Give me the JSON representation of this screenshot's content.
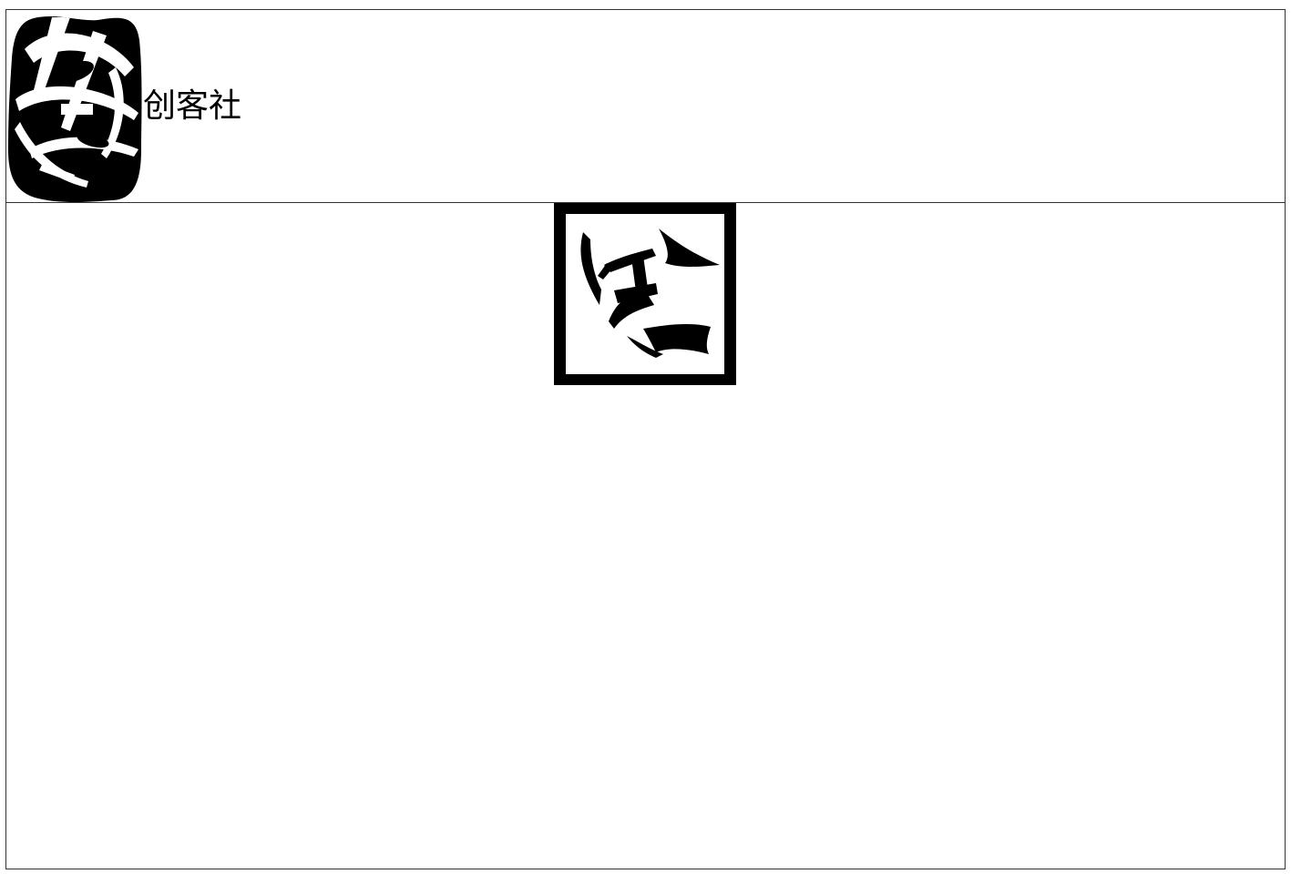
{
  "header": {
    "brand_name": "创客社",
    "logo_icon": "abstract-black-white-logo-icon"
  },
  "main": {
    "emblem_icon": "framed-calligraphy-emblem-icon"
  },
  "colors": {
    "background": "#ffffff",
    "border": "#333333",
    "ink": "#000000"
  }
}
